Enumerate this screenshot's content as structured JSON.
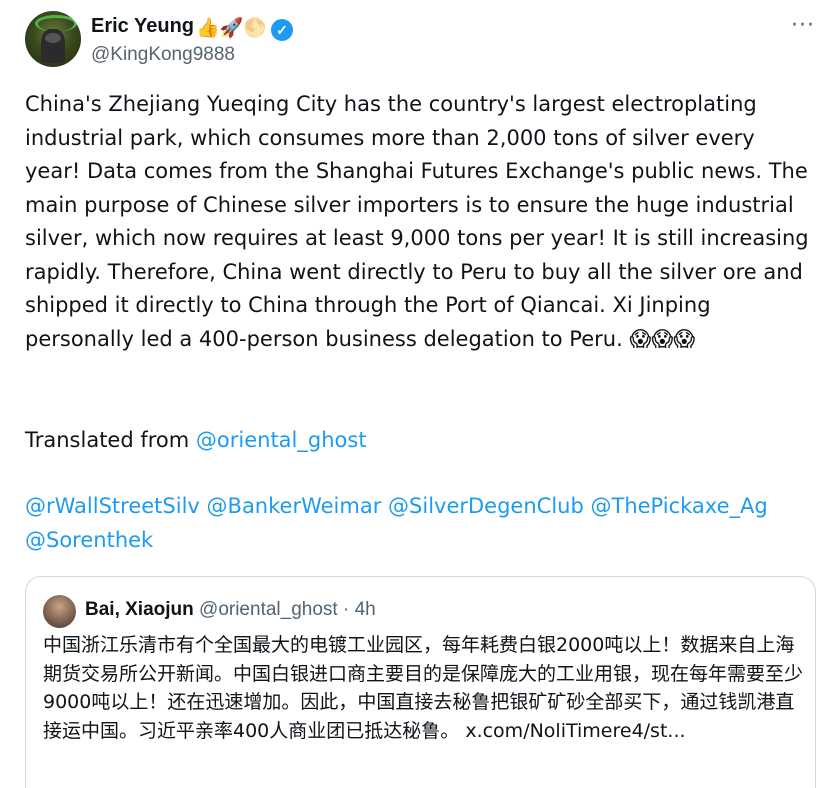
{
  "author": {
    "name": "Eric Yeung",
    "emojis": "👍🚀🌕",
    "verified_glyph": "✓",
    "handle": "@KingKong9888"
  },
  "more_menu_glyph": "···",
  "tweet": {
    "text": "China's Zhejiang Yueqing City has the country's largest electroplating industrial park, which consumes more than 2,000 tons of silver every year! Data comes from the Shanghai Futures Exchange's public news. The main purpose of Chinese silver importers is to ensure the huge industrial silver, which now requires at least 9,000 tons per year! It is still increasing rapidly. Therefore, China went directly to Peru to buy all the silver ore and shipped it directly to China through the Port of Qiancai. Xi Jinping personally led a 400-person business delegation to Peru. 😱😱😱",
    "translated_prefix": "Translated from ",
    "translated_handle": "@oriental_ghost",
    "mentions": [
      "@rWallStreetSilv",
      "@BankerWeimar",
      "@SilverDegenClub",
      "@ThePickaxe_Ag",
      "@Sorenthek"
    ]
  },
  "quoted": {
    "name": "Bai, Xiaojun",
    "handle": "@oriental_ghost",
    "separator": "·",
    "time": "4h",
    "text": "中国浙江乐清市有个全国最大的电镀工业园区，每年耗费白银2000吨以上！数据来自上海期货交易所公开新闻。中国白银进口商主要目的是保障庞大的工业用银，现在每年需要至少9000吨以上！还在迅速增加。因此，中国直接去秘鲁把银矿矿砂全部买下，通过钱凯港直接运中国。习近平亲率400人商业团已抵达秘鲁。",
    "link": "x.com/NoliTimere4/st..."
  },
  "colors": {
    "link": "#1d9bf0",
    "secondary": "#536471",
    "verified": "#1d9bf0",
    "border": "#cfd9de"
  },
  "icons": {
    "verified": "verified-badge-icon",
    "more": "more-options-icon"
  }
}
